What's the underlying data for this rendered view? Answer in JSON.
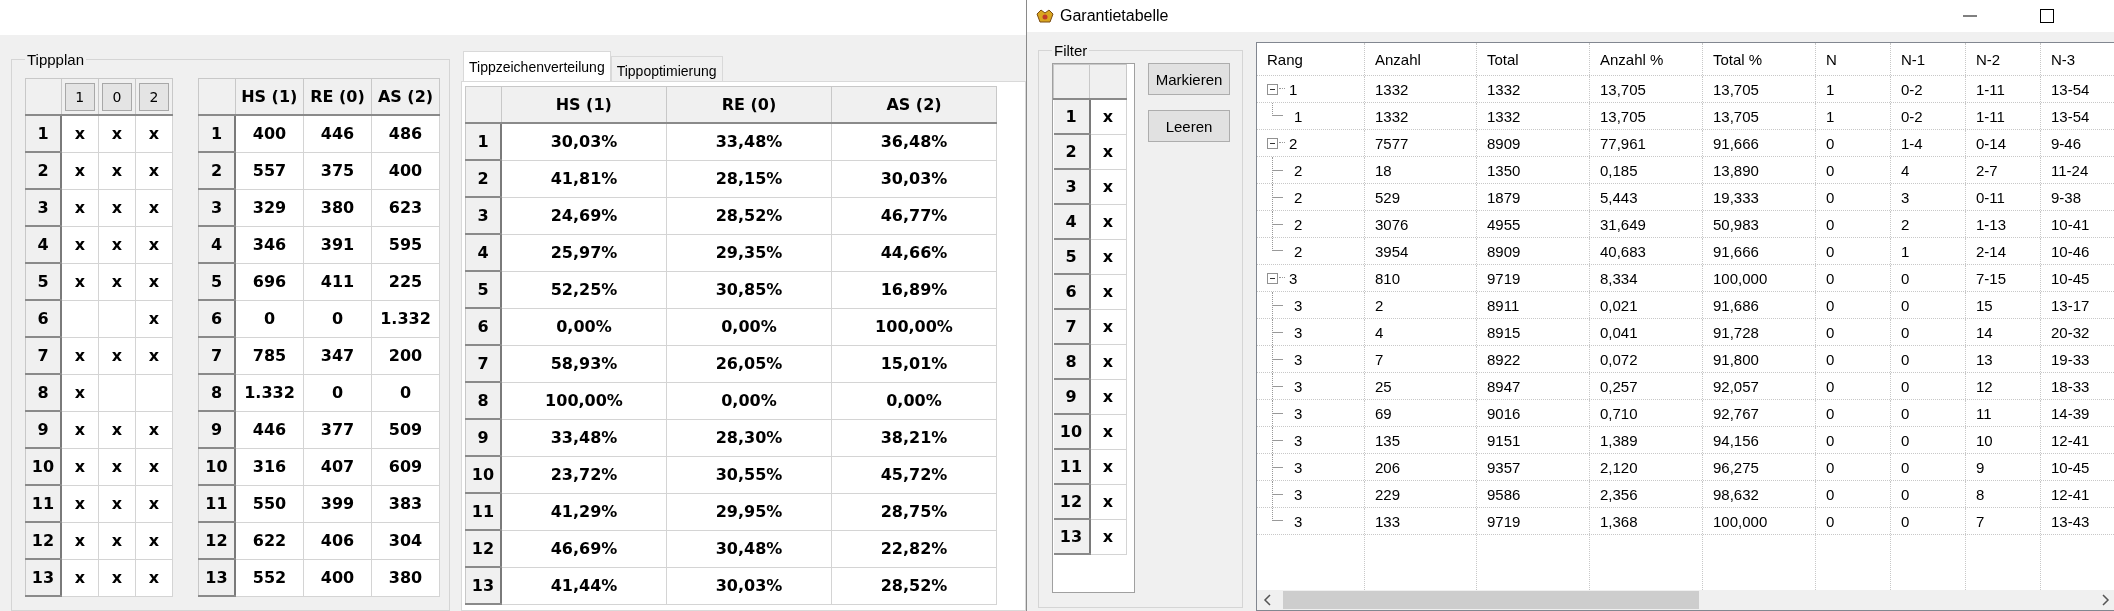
{
  "tippplan": {
    "title": "Tippplan",
    "tip_table": {
      "columns": [
        "1",
        "0",
        "2"
      ],
      "rows": [
        {
          "label": "1",
          "marks": {
            "column_1": "x",
            "column_2": "x",
            "column_3": "x"
          }
        },
        {
          "label": "2",
          "marks": {
            "column_1": "x",
            "column_2": "x",
            "column_3": "x"
          }
        },
        {
          "label": "3",
          "marks": {
            "column_1": "x",
            "column_2": "x",
            "column_3": "x"
          }
        },
        {
          "label": "4",
          "marks": {
            "column_1": "x",
            "column_2": "x",
            "column_3": "x"
          }
        },
        {
          "label": "5",
          "marks": {
            "column_1": "x",
            "column_2": "x",
            "column_3": "x"
          }
        },
        {
          "label": "6",
          "marks": {
            "column_3": "x"
          }
        },
        {
          "label": "7",
          "marks": {
            "column_1": "x",
            "column_2": "x",
            "column_3": "x"
          }
        },
        {
          "label": "8",
          "marks": {
            "column_1": "x"
          }
        },
        {
          "label": "9",
          "marks": {
            "column_1": "x",
            "column_2": "x",
            "column_3": "x"
          }
        },
        {
          "label": "10",
          "marks": {
            "column_1": "x",
            "column_2": "x",
            "column_3": "x"
          }
        },
        {
          "label": "11",
          "marks": {
            "column_1": "x",
            "column_2": "x",
            "column_3": "x"
          }
        },
        {
          "label": "12",
          "marks": {
            "column_1": "x",
            "column_2": "x",
            "column_3": "x"
          }
        },
        {
          "label": "13",
          "marks": {
            "column_1": "x",
            "column_2": "x",
            "column_3": "x"
          }
        }
      ]
    },
    "count_table": {
      "columns": [
        "HS (1)",
        "RE (0)",
        "AS (2)"
      ],
      "rows": [
        {
          "label": "1",
          "cells": [
            "400",
            "446",
            "486"
          ]
        },
        {
          "label": "2",
          "cells": [
            "557",
            "375",
            "400"
          ]
        },
        {
          "label": "3",
          "cells": [
            "329",
            "380",
            "623"
          ]
        },
        {
          "label": "4",
          "cells": [
            "346",
            "391",
            "595"
          ]
        },
        {
          "label": "5",
          "cells": [
            "696",
            "411",
            "225"
          ]
        },
        {
          "label": "6",
          "cells": [
            "0",
            "0",
            "1.332"
          ]
        },
        {
          "label": "7",
          "cells": [
            "785",
            "347",
            "200"
          ]
        },
        {
          "label": "8",
          "cells": [
            "1.332",
            "0",
            "0"
          ]
        },
        {
          "label": "9",
          "cells": [
            "446",
            "377",
            "509"
          ]
        },
        {
          "label": "10",
          "cells": [
            "316",
            "407",
            "609"
          ]
        },
        {
          "label": "11",
          "cells": [
            "550",
            "399",
            "383"
          ]
        },
        {
          "label": "12",
          "cells": [
            "622",
            "406",
            "304"
          ]
        },
        {
          "label": "13",
          "cells": [
            "552",
            "400",
            "380"
          ]
        }
      ]
    }
  },
  "tabs": [
    {
      "label": "Tippzeichenverteilung",
      "selected": true
    },
    {
      "label": "Tippoptimierung",
      "selected": false
    }
  ],
  "distribution_table": {
    "columns": [
      "HS (1)",
      "RE (0)",
      "AS (2)"
    ],
    "rows": [
      {
        "label": "1",
        "cells": [
          "30,03%",
          "33,48%",
          "36,48%"
        ]
      },
      {
        "label": "2",
        "cells": [
          "41,81%",
          "28,15%",
          "30,03%"
        ]
      },
      {
        "label": "3",
        "cells": [
          "24,69%",
          "28,52%",
          "46,77%"
        ]
      },
      {
        "label": "4",
        "cells": [
          "25,97%",
          "29,35%",
          "44,66%"
        ]
      },
      {
        "label": "5",
        "cells": [
          "52,25%",
          "30,85%",
          "16,89%"
        ]
      },
      {
        "label": "6",
        "cells": [
          "0,00%",
          "0,00%",
          "100,00%"
        ]
      },
      {
        "label": "7",
        "cells": [
          "58,93%",
          "26,05%",
          "15,01%"
        ]
      },
      {
        "label": "8",
        "cells": [
          "100,00%",
          "0,00%",
          "0,00%"
        ]
      },
      {
        "label": "9",
        "cells": [
          "33,48%",
          "28,30%",
          "38,21%"
        ]
      },
      {
        "label": "10",
        "cells": [
          "23,72%",
          "30,55%",
          "45,72%"
        ]
      },
      {
        "label": "11",
        "cells": [
          "41,29%",
          "29,95%",
          "28,75%"
        ]
      },
      {
        "label": "12",
        "cells": [
          "46,69%",
          "30,48%",
          "22,82%"
        ]
      },
      {
        "label": "13",
        "cells": [
          "41,44%",
          "30,03%",
          "28,52%"
        ]
      }
    ]
  },
  "guarantee_window": {
    "title": "Garantietabelle",
    "filter": {
      "title": "Filter",
      "rows": [
        {
          "label": "1",
          "mark": "x"
        },
        {
          "label": "2",
          "mark": "x"
        },
        {
          "label": "3",
          "mark": "x"
        },
        {
          "label": "4",
          "mark": "x"
        },
        {
          "label": "5",
          "mark": "x"
        },
        {
          "label": "6",
          "mark": "x"
        },
        {
          "label": "7",
          "mark": "x"
        },
        {
          "label": "8",
          "mark": "x"
        },
        {
          "label": "9",
          "mark": "x"
        },
        {
          "label": "10",
          "mark": "x"
        },
        {
          "label": "11",
          "mark": "x"
        },
        {
          "label": "12",
          "mark": "x"
        },
        {
          "label": "13",
          "mark": "x"
        }
      ],
      "buttons": [
        "Markieren",
        "Leeren"
      ]
    },
    "tree": {
      "columns": [
        "Rang",
        "Anzahl",
        "Total",
        "Anzahl %",
        "Total %",
        "N",
        "N-1",
        "N-2",
        "N-3"
      ],
      "rows": [
        {
          "cells": [
            "1",
            "1332",
            "1332",
            "13,705",
            "13,705",
            "1",
            "0-2",
            "1-11",
            "13-54"
          ],
          "expanded": true,
          "children": [
            {
              "cells": [
                "1",
                "1332",
                "1332",
                "13,705",
                "13,705",
                "1",
                "0-2",
                "1-11",
                "13-54"
              ]
            }
          ]
        },
        {
          "cells": [
            "2",
            "7577",
            "8909",
            "77,961",
            "91,666",
            "0",
            "1-4",
            "0-14",
            "9-46"
          ],
          "expanded": true,
          "children": [
            {
              "cells": [
                "2",
                "18",
                "1350",
                "0,185",
                "13,890",
                "0",
                "4",
                "2-7",
                "11-24"
              ]
            },
            {
              "cells": [
                "2",
                "529",
                "1879",
                "5,443",
                "19,333",
                "0",
                "3",
                "0-11",
                "9-38"
              ]
            },
            {
              "cells": [
                "2",
                "3076",
                "4955",
                "31,649",
                "50,983",
                "0",
                "2",
                "1-13",
                "10-41"
              ]
            },
            {
              "cells": [
                "2",
                "3954",
                "8909",
                "40,683",
                "91,666",
                "0",
                "1",
                "2-14",
                "10-46"
              ]
            }
          ]
        },
        {
          "cells": [
            "3",
            "810",
            "9719",
            "8,334",
            "100,000",
            "0",
            "0",
            "7-15",
            "10-45"
          ],
          "expanded": true,
          "children": [
            {
              "cells": [
                "3",
                "2",
                "8911",
                "0,021",
                "91,686",
                "0",
                "0",
                "15",
                "13-17"
              ]
            },
            {
              "cells": [
                "3",
                "4",
                "8915",
                "0,041",
                "91,728",
                "0",
                "0",
                "14",
                "20-32"
              ]
            },
            {
              "cells": [
                "3",
                "7",
                "8922",
                "0,072",
                "91,800",
                "0",
                "0",
                "13",
                "19-33"
              ]
            },
            {
              "cells": [
                "3",
                "25",
                "8947",
                "0,257",
                "92,057",
                "0",
                "0",
                "12",
                "18-33"
              ]
            },
            {
              "cells": [
                "3",
                "69",
                "9016",
                "0,710",
                "92,767",
                "0",
                "0",
                "11",
                "14-39"
              ]
            },
            {
              "cells": [
                "3",
                "135",
                "9151",
                "1,389",
                "94,156",
                "0",
                "0",
                "10",
                "12-41"
              ]
            },
            {
              "cells": [
                "3",
                "206",
                "9357",
                "2,120",
                "96,275",
                "0",
                "0",
                "9",
                "10-45"
              ]
            },
            {
              "cells": [
                "3",
                "229",
                "9586",
                "2,356",
                "98,632",
                "0",
                "0",
                "8",
                "12-41"
              ]
            },
            {
              "cells": [
                "3",
                "133",
                "9719",
                "1,368",
                "100,000",
                "0",
                "0",
                "7",
                "13-43"
              ]
            }
          ]
        }
      ]
    }
  }
}
